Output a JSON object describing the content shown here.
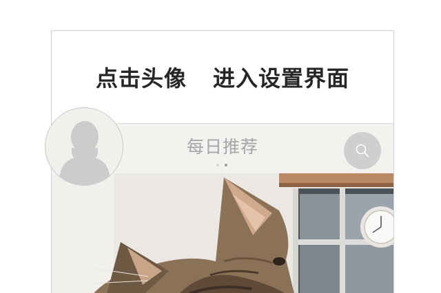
{
  "tooltip": {
    "part1": "点击头像",
    "part2": "进入设置界面"
  },
  "header": {
    "title": "每日推荐",
    "page_indicator": {
      "count": 2,
      "active": 2
    }
  },
  "icons": {
    "avatar": "person-silhouette-icon",
    "search": "search-icon"
  },
  "colors": {
    "header_background": "#f3f2ee",
    "title_text": "#a5a5a5",
    "search_button": "#cfcfcf",
    "avatar_silhouette": "#cccccc"
  }
}
